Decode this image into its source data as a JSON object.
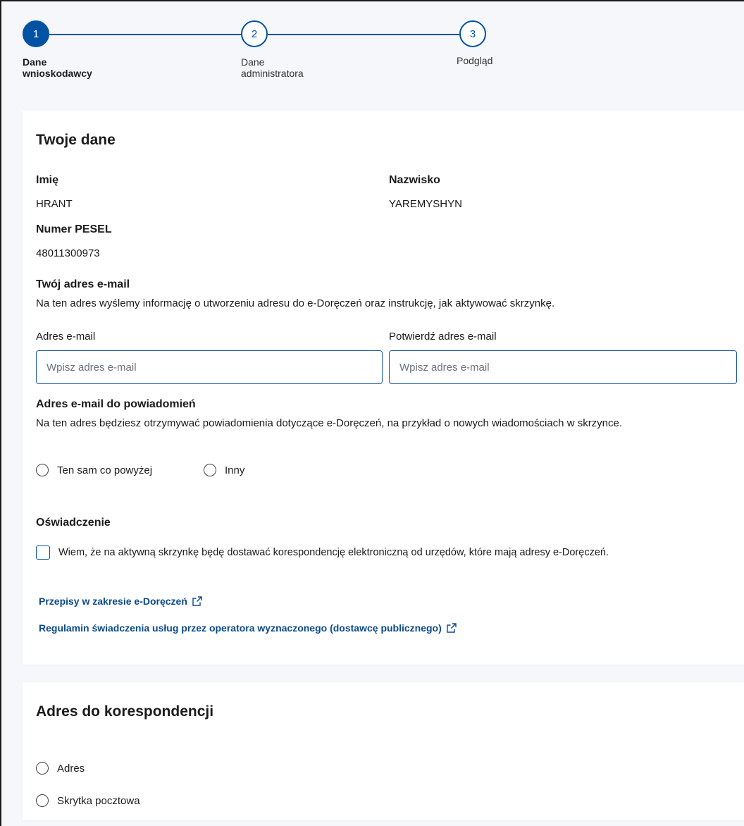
{
  "stepper": {
    "steps": [
      {
        "number": "1",
        "label_line1": "Dane",
        "label_line2": "wnioskodawcy"
      },
      {
        "number": "2",
        "label_line1": "Dane",
        "label_line2": "administratora"
      },
      {
        "number": "3",
        "label_line1": "Podgląd",
        "label_line2": ""
      }
    ],
    "active_step": 1
  },
  "your_data": {
    "title": "Twoje dane",
    "first_name_label": "Imię",
    "first_name_value": "HRANT",
    "last_name_label": "Nazwisko",
    "last_name_value": "YAREMYSHYN",
    "pesel_label": "Numer PESEL",
    "pesel_value": "48011300973",
    "email_section_title": "Twój adres e-mail",
    "email_section_desc": "Na ten adres wyślemy informację o utworzeniu adresu do e-Doręczeń oraz instrukcję, jak aktywować skrzynkę.",
    "email_label": "Adres e-mail",
    "email_placeholder": "Wpisz adres e-mail",
    "email_value": "",
    "confirm_email_label": "Potwierdź adres e-mail",
    "confirm_email_placeholder": "Wpisz adres e-mail",
    "confirm_email_value": "",
    "notify_title": "Adres e-mail do powiadomień",
    "notify_desc": "Na ten adres będziesz otrzymywać powiadomienia dotyczące e-Doręczeń, na przykład o nowych wiadomościach w skrzynce.",
    "notify_option_same": "Ten sam co powyżej",
    "notify_option_other": "Inny",
    "declaration_title": "Oświadczenie",
    "declaration_text": "Wiem, że na aktywną skrzynkę będę dostawać korespondencję elektroniczną od urzędów, które mają adresy e-Doręczeń.",
    "link_regulations": "Przepisy w zakresie e-Doręczeń",
    "link_terms": "Regulamin świadczenia usług przez operatora wyznaczonego (dostawcę publicznego)"
  },
  "correspondence": {
    "title": "Adres do korespondencji",
    "option_address": "Adres",
    "option_po_box": "Skrytka pocztowa"
  },
  "colors": {
    "primary": "#0052a5",
    "link": "#0b4a8b",
    "background": "#f5f7fa"
  }
}
